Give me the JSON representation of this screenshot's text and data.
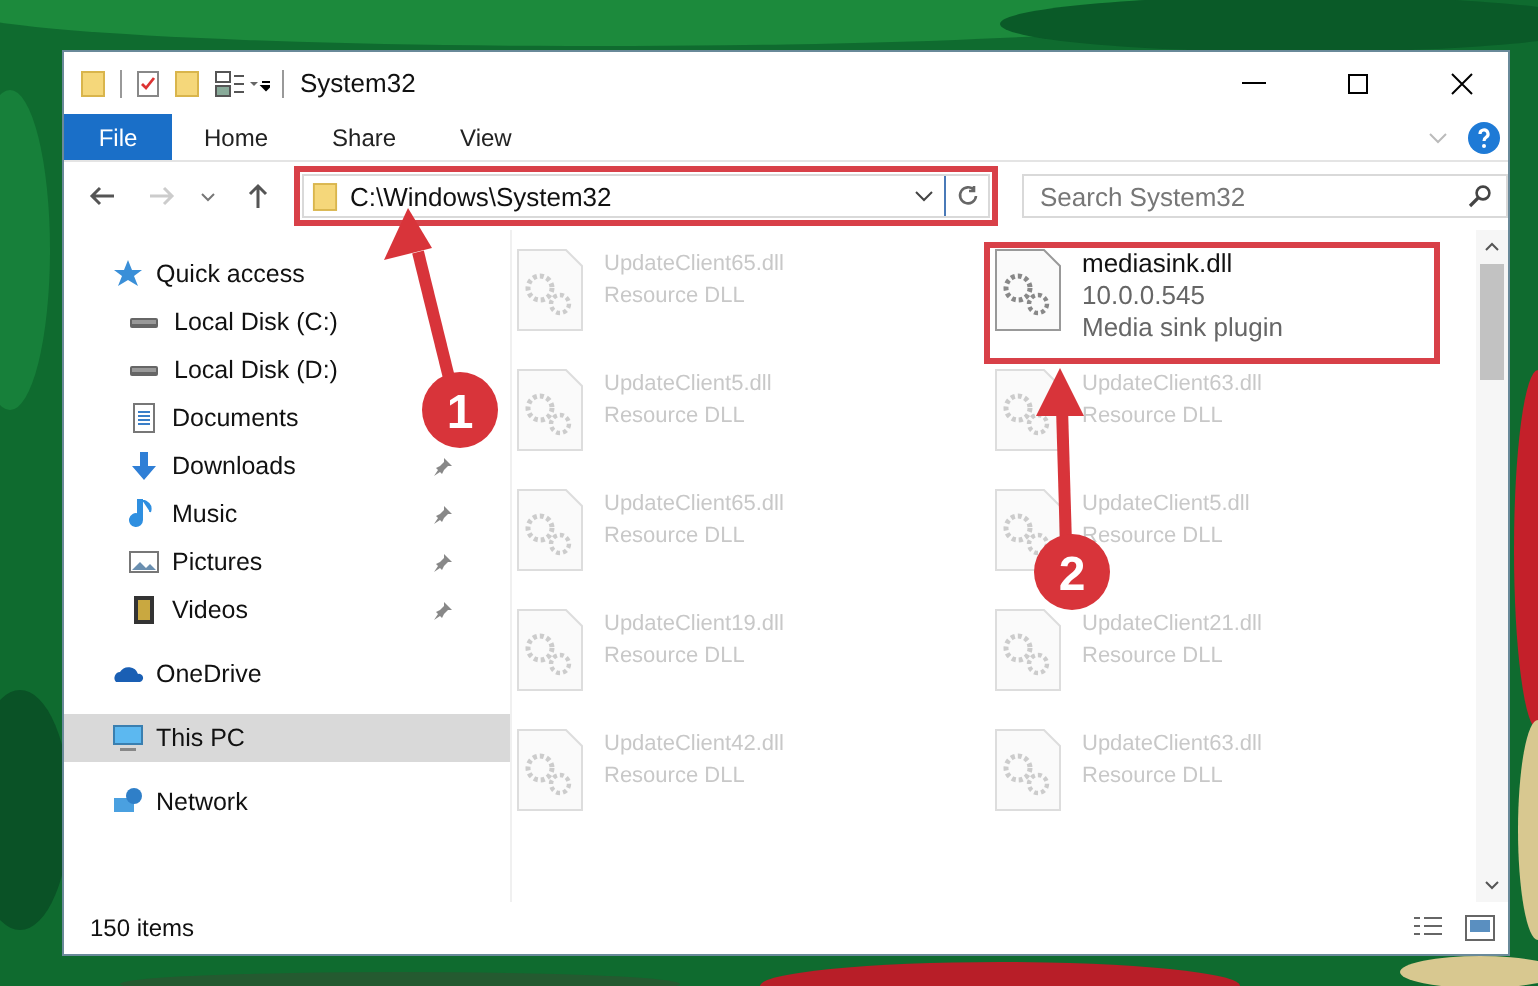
{
  "window": {
    "title": "System32"
  },
  "ribbon_tabs": [
    {
      "label": "File",
      "selected": true
    },
    {
      "label": "Home",
      "selected": false
    },
    {
      "label": "Share",
      "selected": false
    },
    {
      "label": "View",
      "selected": false
    }
  ],
  "address_bar": {
    "path": "C:\\Windows\\System32",
    "framed": true
  },
  "search": {
    "placeholder": "Search System32"
  },
  "sidebar": {
    "items": [
      {
        "label": "Quick access",
        "kind": "star",
        "selected": false,
        "children": [
          {
            "label": "Local Disk (C:)",
            "kind": "drive",
            "selected": false,
            "pinned": false
          },
          {
            "label": "Local Disk (D:)",
            "kind": "drive",
            "selected": false,
            "pinned": false
          },
          {
            "label": "Documents",
            "kind": "doc",
            "selected": false,
            "pinned": false
          },
          {
            "label": "Downloads",
            "kind": "download",
            "selected": false,
            "pinned": true
          },
          {
            "label": "Music",
            "kind": "music",
            "selected": false,
            "pinned": true
          },
          {
            "label": "Pictures",
            "kind": "pictures",
            "selected": false,
            "pinned": true
          },
          {
            "label": "Videos",
            "kind": "videos",
            "selected": false,
            "pinned": true
          }
        ]
      },
      {
        "label": "OneDrive",
        "kind": "cloud",
        "selected": false
      },
      {
        "label": "This PC",
        "kind": "pc",
        "selected": true
      },
      {
        "label": "Network",
        "kind": "network",
        "selected": false
      }
    ]
  },
  "files": [
    {
      "name": "UpdateClient65.dll",
      "lines": [
        "Resource DLL"
      ],
      "dimmed": true
    },
    {
      "name": "mediasink.dll",
      "lines": [
        "10.0.0.545",
        "Media sink plugin"
      ],
      "dimmed": false,
      "framed": true
    },
    {
      "name": "UpdateClient5.dll",
      "lines": [
        "Resource DLL"
      ],
      "dimmed": true
    },
    {
      "name": "UpdateClient63.dll",
      "lines": [
        "Resource DLL"
      ],
      "dimmed": true
    },
    {
      "name": "UpdateClient65.dll",
      "lines": [
        "Resource DLL"
      ],
      "dimmed": true
    },
    {
      "name": "UpdateClient5.dll",
      "lines": [
        "Resource DLL"
      ],
      "dimmed": true
    },
    {
      "name": "UpdateClient19.dll",
      "lines": [
        "Resource DLL"
      ],
      "dimmed": true
    },
    {
      "name": "UpdateClient21.dll",
      "lines": [
        "Resource DLL"
      ],
      "dimmed": true
    },
    {
      "name": "UpdateClient42.dll",
      "lines": [
        "Resource DLL"
      ],
      "dimmed": true
    },
    {
      "name": "UpdateClient63.dll",
      "lines": [
        "Resource DLL"
      ],
      "dimmed": true
    }
  ],
  "status_bar": {
    "count": "150 items"
  },
  "callouts": [
    {
      "number": "1"
    },
    {
      "number": "2"
    }
  ]
}
